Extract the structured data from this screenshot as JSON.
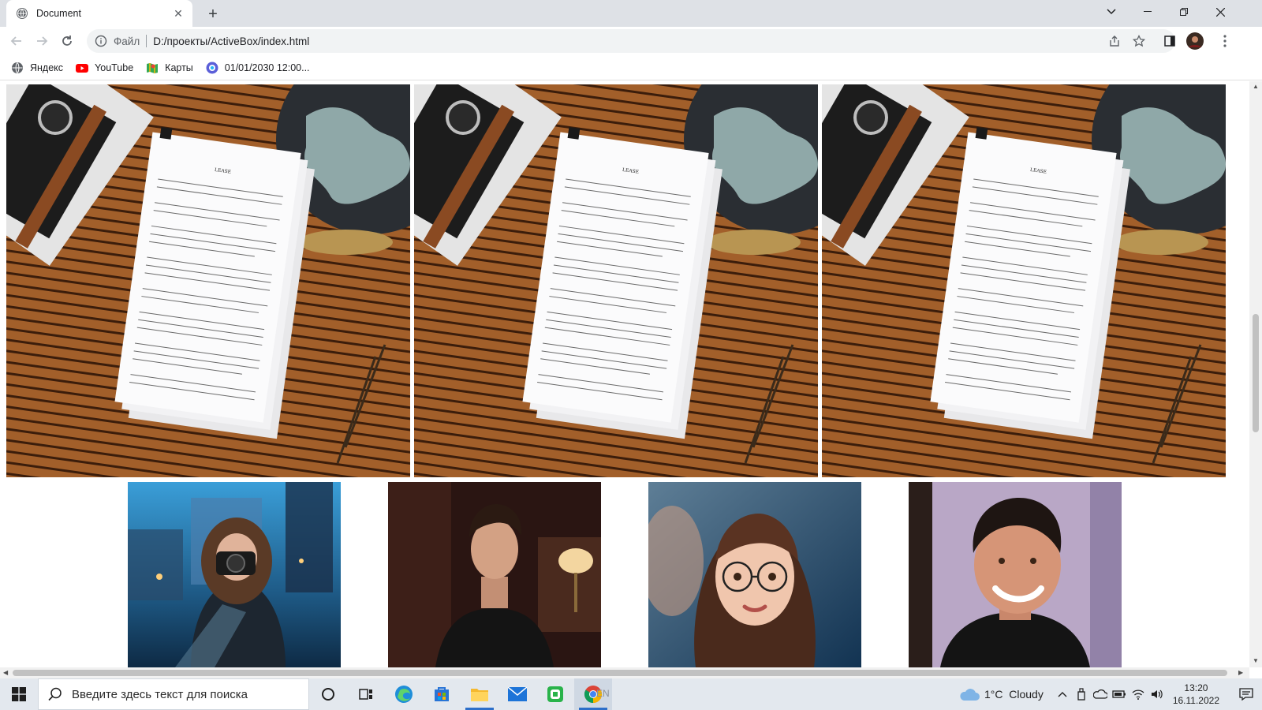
{
  "browser": {
    "tab": {
      "title": "Document"
    },
    "omnibox": {
      "scheme": "Файл",
      "url": "D:/проекты/ActiveBox/index.html"
    },
    "bookmarks": [
      {
        "label": "Яндекс",
        "icon": "globe-icon"
      },
      {
        "label": "YouTube",
        "icon": "youtube-icon"
      },
      {
        "label": "Карты",
        "icon": "maps-icon"
      },
      {
        "label": "01/01/2030 12:00...",
        "icon": "circle-app-icon"
      }
    ]
  },
  "page": {
    "hero_images": [
      {
        "alt": "lease-document-on-desk-1"
      },
      {
        "alt": "lease-document-on-desk-2"
      },
      {
        "alt": "lease-document-on-desk-3"
      }
    ],
    "portraits": [
      {
        "alt": "woman-with-camera"
      },
      {
        "alt": "young-man-black-tshirt"
      },
      {
        "alt": "cartoon-woman-glasses"
      },
      {
        "alt": "smiling-man"
      }
    ]
  },
  "taskbar": {
    "search_placeholder": "Введите здесь текст для поиска",
    "language": "EN",
    "weather": "1°C  Cloudy",
    "time": "13:20",
    "date": "16.11.2022"
  },
  "colors": {
    "accent": "#1a73e8",
    "tabstrip": "#dee1e6",
    "taskbar": "#e3e8ee",
    "wood": "#9b5a26"
  }
}
